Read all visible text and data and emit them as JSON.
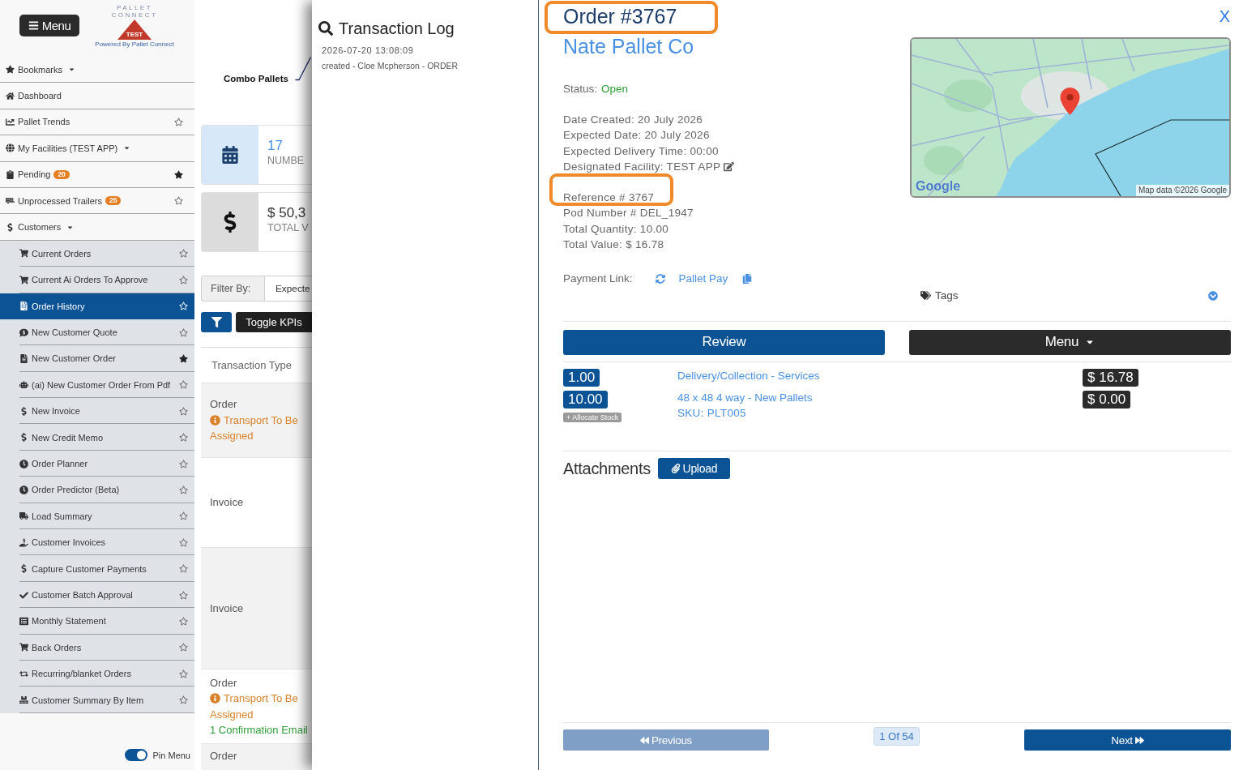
{
  "sidebar": {
    "menu_button": "Menu",
    "logo": {
      "lines": [
        "PALLET",
        "CONNECT"
      ],
      "badge": "TEST",
      "tagline": "Powered By Pallet Connect"
    },
    "items": [
      {
        "label": "Bookmarks",
        "kind": "dropdown"
      },
      {
        "label": "Dashboard",
        "kind": "link"
      },
      {
        "label": "Pallet Trends",
        "kind": "link",
        "bookmarked": false
      },
      {
        "label": "My Facilities (TEST APP)",
        "kind": "dropdown"
      },
      {
        "label": "Pending",
        "kind": "link",
        "badge": "20",
        "bookmarked": true
      },
      {
        "label": "Unprocessed Trailers",
        "kind": "link",
        "badge": "25",
        "bookmarked": false
      },
      {
        "label": "Customers",
        "kind": "dropdown",
        "expanded": true,
        "children": [
          {
            "label": "Current Orders",
            "bookmarked": false,
            "selected": false
          },
          {
            "label": "Current Ai Orders To Approve",
            "bookmarked": false,
            "selected": false
          },
          {
            "label": "Order History",
            "bookmarked": false,
            "selected": true
          },
          {
            "label": "New Customer Quote",
            "bookmarked": false,
            "selected": false
          },
          {
            "label": "New Customer Order",
            "bookmarked": true,
            "selected": false
          },
          {
            "label": "(ai) New Customer Order From Pdf",
            "bookmarked": false,
            "selected": false
          },
          {
            "label": "New Invoice",
            "bookmarked": false,
            "selected": false
          },
          {
            "label": "New Credit Memo",
            "bookmarked": false,
            "selected": false
          },
          {
            "label": "Order Planner",
            "bookmarked": false,
            "selected": false
          },
          {
            "label": "Order Predictor (Beta)",
            "bookmarked": false,
            "selected": false
          },
          {
            "label": "Load Summary",
            "bookmarked": false,
            "selected": false
          },
          {
            "label": "Customer Invoices",
            "bookmarked": false,
            "selected": false
          },
          {
            "label": "Capture Customer Payments",
            "bookmarked": false,
            "selected": false
          },
          {
            "label": "Customer Batch Approval",
            "bookmarked": false,
            "selected": false
          },
          {
            "label": "Monthly Statement",
            "bookmarked": false,
            "selected": false
          },
          {
            "label": "Back Orders",
            "bookmarked": false,
            "selected": false
          },
          {
            "label": "Recurring/blanket Orders",
            "bookmarked": false,
            "selected": false
          },
          {
            "label": "Customer Summary By Item",
            "bookmarked": false,
            "selected": false
          }
        ]
      }
    ],
    "pin_menu": {
      "label": "Pin Menu",
      "on": true
    }
  },
  "background_page": {
    "section_title": "Combo Pallets",
    "kpis": [
      {
        "kind": "calendar",
        "value": "17",
        "label": "NUMBE"
      },
      {
        "kind": "money",
        "value": "$ 50,3",
        "label": "TOTAL V"
      }
    ],
    "filter": {
      "label": "Filter By:",
      "value": "Expecte"
    },
    "toggle_button": "Toggle KPIs",
    "table": {
      "columns": [
        "Transaction Type"
      ],
      "rows": [
        {
          "type": "Order",
          "notes": [
            {
              "kind": "warning",
              "text": "Transport To Be Assigned"
            }
          ]
        },
        {
          "type": "Invoice"
        },
        {
          "type": "Invoice"
        },
        {
          "type": "Order",
          "notes": [
            {
              "kind": "warning",
              "text": "Transport To Be Assigned"
            },
            {
              "kind": "success",
              "text": "1 Confirmation Email"
            }
          ]
        },
        {
          "type": "Order"
        }
      ]
    }
  },
  "transaction_log": {
    "title": "Transaction Log",
    "entries": [
      {
        "time": "2026-07-20 13:08:09",
        "text": "created - Cloe Mcpherson - ORDER"
      }
    ]
  },
  "order": {
    "title": {
      "text": "Order #3767",
      "highlighted": true
    },
    "customer": "Nate Pallet Co",
    "close": "X",
    "map": {
      "logo": "Google",
      "attribution": "Map data ©2026 Google"
    },
    "status": {
      "label": "Status:",
      "value": "Open"
    },
    "dates": [
      {
        "text": "Date Created: 20 July 2026",
        "editable": false
      },
      {
        "text": "Expected Date: 20 July 2026",
        "editable": false
      },
      {
        "text": "Expected Delivery Time: 00:00",
        "editable": false
      },
      {
        "text": "Designated Facility: TEST APP",
        "editable": true
      }
    ],
    "references": [
      {
        "text": "Reference # 3767",
        "highlighted": true
      },
      {
        "text": "Pod Number # DEL_1947",
        "highlighted": false
      },
      {
        "text": "Total Quantity: 10.00",
        "highlighted": false
      },
      {
        "text": "Total Value: $ 16.78",
        "highlighted": false
      }
    ],
    "payment_link": {
      "label": "Payment Link:",
      "link": "Pallet Pay"
    },
    "tags": {
      "label": "Tags"
    },
    "actions": [
      {
        "label": "Review",
        "kind": "primary"
      },
      {
        "label": "Menu",
        "kind": "dropdown"
      }
    ],
    "line_items": [
      {
        "quantity": "1.00",
        "description": "Delivery/Collection - Services",
        "price": "$ 16.78"
      },
      {
        "quantity": "10.00",
        "allocate": "+ Allocate Stock",
        "description": "48 x 48 4 way - New Pallets",
        "sku": "SKU: PLT005",
        "price": "$ 0.00"
      }
    ],
    "attachments": {
      "title": "Attachments",
      "button": "Upload"
    },
    "pagination": {
      "previous": {
        "label": "Previous",
        "disabled": true
      },
      "page": "1 Of 54",
      "next": {
        "label": "Next",
        "disabled": false
      }
    }
  }
}
